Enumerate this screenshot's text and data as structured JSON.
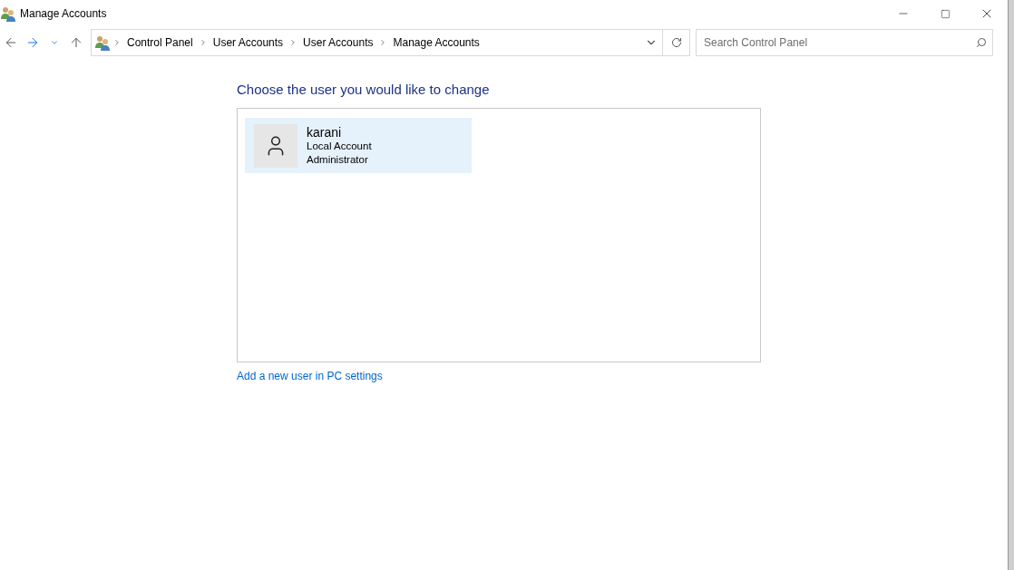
{
  "window": {
    "title": "Manage Accounts"
  },
  "address_bar": {
    "breadcrumbs": [
      "Control Panel",
      "User Accounts",
      "User Accounts",
      "Manage Accounts"
    ]
  },
  "search": {
    "placeholder": "Search Control Panel"
  },
  "heading": "Choose the user you would like to change",
  "accounts": [
    {
      "name": "karani",
      "type": "Local Account",
      "role": "Administrator",
      "selected": true
    }
  ],
  "add_user_link": "Add a new user in PC settings"
}
